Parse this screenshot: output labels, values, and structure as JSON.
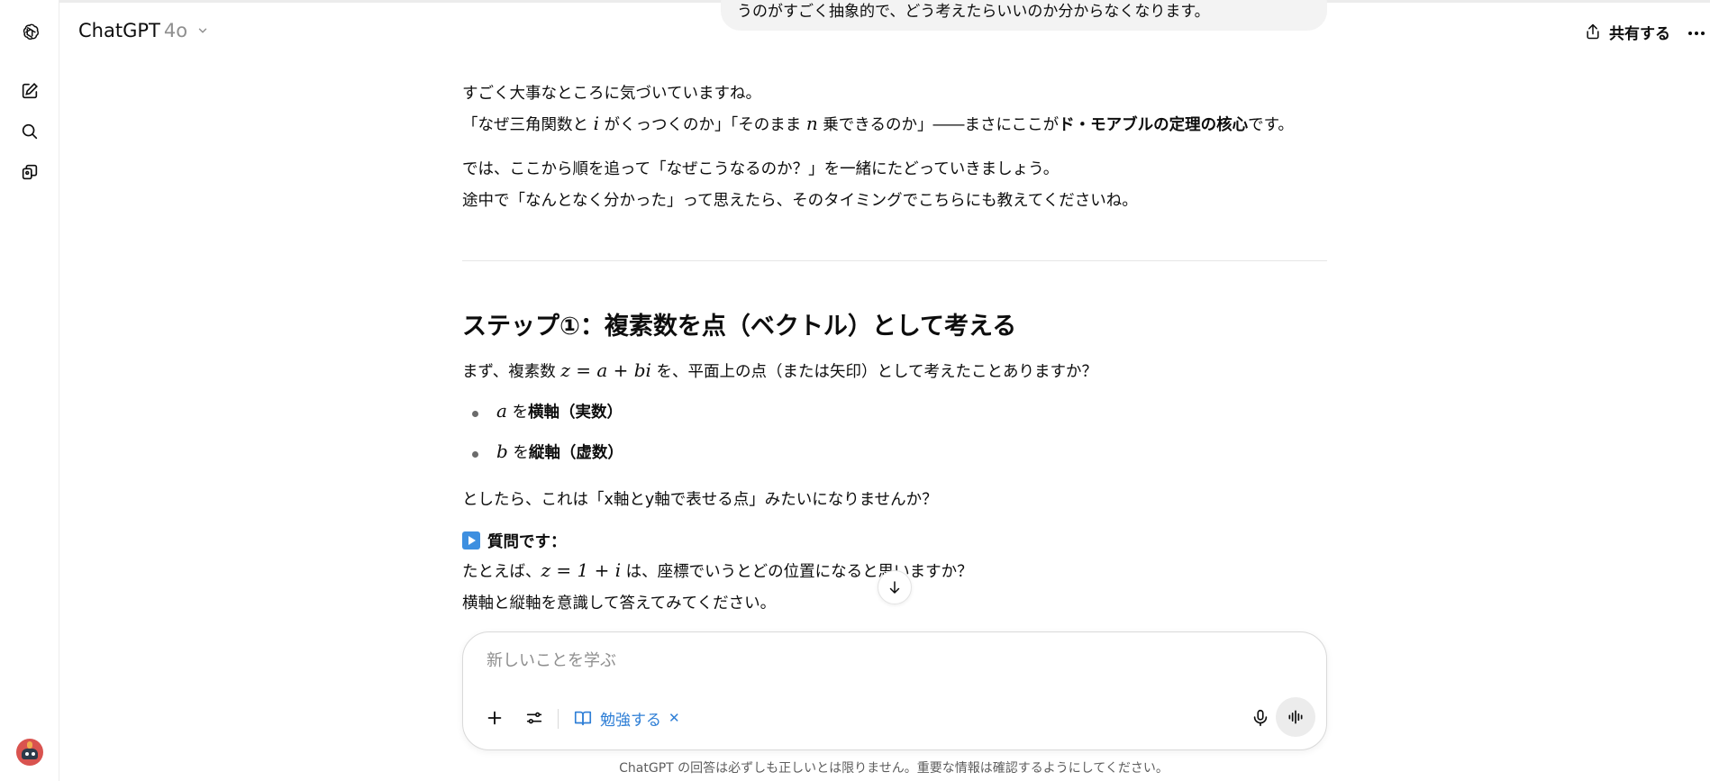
{
  "app": {
    "title": "ChatGPT",
    "model": "4o"
  },
  "header": {
    "share_label": "共有する"
  },
  "sidebar": {
    "items": [
      {
        "icon": "new-chat-icon"
      },
      {
        "icon": "search-icon"
      },
      {
        "icon": "library-icon"
      }
    ]
  },
  "user_message": {
    "partial_text": "うのがすごく抽象的で、どう考えたらいいのか分からなくなります。"
  },
  "assistant": {
    "intro_line1": "すごく大事なところに気づいていますね。",
    "intro_line2_a": "「なぜ三角関数と ",
    "intro_line2_i": "i",
    "intro_line2_b": " がくっつくのか」「そのまま ",
    "intro_line2_n": "n",
    "intro_line2_c": " 乗できるのか」――まさにここが",
    "intro_line2_bold": "ド・モアブルの定理の核心",
    "intro_line2_d": "です。",
    "intro_line3": "では、ここから順を追って「なぜこうなるのか？」を一緒にたどっていきましょう。",
    "intro_line4": "途中で「なんとなく分かった」って思えたら、そのタイミングでこちらにも教えてくださいね。",
    "step_heading": "ステップ①：複素数を点（ベクトル）として考える",
    "step_p1_a": "まず、複素数 ",
    "step_p1_math": "z = a + bi",
    "step_p1_b": " を、平面上の点（または矢印）として考えたことありますか？",
    "bullet1_var": "a",
    "bullet1_a": " を",
    "bullet1_bold": "横軸（実数）",
    "bullet2_var": "b",
    "bullet2_a": " を",
    "bullet2_bold": "縦軸（虚数）",
    "step_p2": "としたら、これは「x軸とy軸で表せる点」みたいになりませんか？",
    "question_label": "質問です：",
    "question_a": "たとえば、",
    "question_math": "z = 1 + i",
    "question_b": " は、座標でいうとどの位置になると思いますか？",
    "question_line2": "横軸と縦軸を意識して答えてみてください。"
  },
  "composer": {
    "placeholder": "新しいことを学ぶ",
    "study_chip_label": "勉強する",
    "study_chip_close": "✕"
  },
  "footer": {
    "disclaimer": "ChatGPT の回答は必ずしも正しいとは限りません。重要な情報は確認するようにしてください。"
  },
  "colors": {
    "accent_blue": "#2f7fd6",
    "question_icon_blue": "#3d8fe0"
  }
}
